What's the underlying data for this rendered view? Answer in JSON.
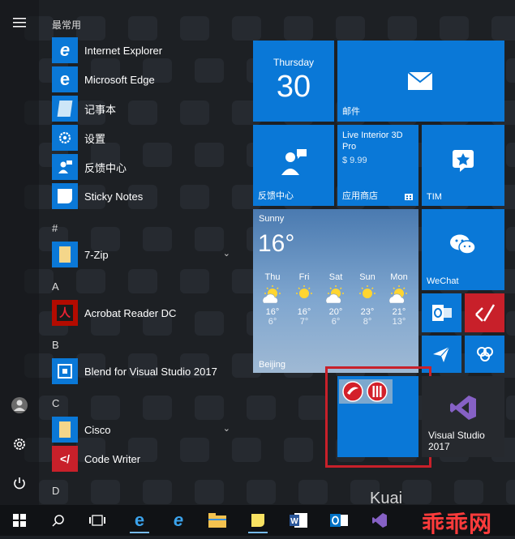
{
  "rail": {
    "menu_icon": "hamburger-icon",
    "user_icon": "user-icon",
    "settings_icon": "gear-icon",
    "power_icon": "power-icon"
  },
  "app_list": {
    "most_used_header": "最常用",
    "most_used": [
      {
        "label": "Internet Explorer",
        "icon": "internet-explorer-icon"
      },
      {
        "label": "Microsoft Edge",
        "icon": "edge-icon"
      },
      {
        "label": "记事本",
        "icon": "notepad-icon"
      },
      {
        "label": "设置",
        "icon": "settings-icon"
      },
      {
        "label": "反馈中心",
        "icon": "feedback-icon"
      },
      {
        "label": "Sticky Notes",
        "icon": "sticky-notes-icon"
      }
    ],
    "groups": [
      {
        "letter": "#",
        "items": [
          {
            "label": "7-Zip",
            "icon": "folder-icon",
            "expandable": true
          }
        ]
      },
      {
        "letter": "A",
        "items": [
          {
            "label": "Acrobat Reader DC",
            "icon": "acrobat-icon"
          }
        ]
      },
      {
        "letter": "B",
        "items": [
          {
            "label": "Blend for Visual Studio 2017",
            "icon": "blend-icon"
          }
        ]
      },
      {
        "letter": "C",
        "items": [
          {
            "label": "Cisco",
            "icon": "folder-icon",
            "expandable": true
          },
          {
            "label": "Code Writer",
            "icon": "code-writer-icon"
          }
        ]
      },
      {
        "letter": "D",
        "items": []
      }
    ]
  },
  "tiles": {
    "calendar": {
      "day_name": "Thursday",
      "day_number": "30"
    },
    "mail": {
      "label": "邮件"
    },
    "feedback": {
      "label": "反馈中心"
    },
    "store": {
      "app_name": "Live Interior 3D Pro",
      "price": "$ 9.99",
      "label": "应用商店"
    },
    "tim": {
      "label": "TIM"
    },
    "weather": {
      "condition": "Sunny",
      "current_temp": "16°",
      "city": "Beijing",
      "forecast": [
        {
          "day": "Thu",
          "high": "16°",
          "low": "6°"
        },
        {
          "day": "Fri",
          "high": "16°",
          "low": "7°"
        },
        {
          "day": "Sat",
          "high": "20°",
          "low": "6°"
        },
        {
          "day": "Sun",
          "high": "23°",
          "low": "8°"
        },
        {
          "day": "Mon",
          "high": "21°",
          "low": "13°"
        }
      ]
    },
    "wechat": {
      "label": "WeChat"
    },
    "visual_studio": {
      "label": "Visual Studio 2017"
    }
  },
  "watermark": {
    "text": "Kuai",
    "brand": "乖乖网"
  },
  "colors": {
    "tile_blue": "#0a78d7",
    "highlight_red": "#c8202a",
    "vs_purple": "#68217a"
  }
}
